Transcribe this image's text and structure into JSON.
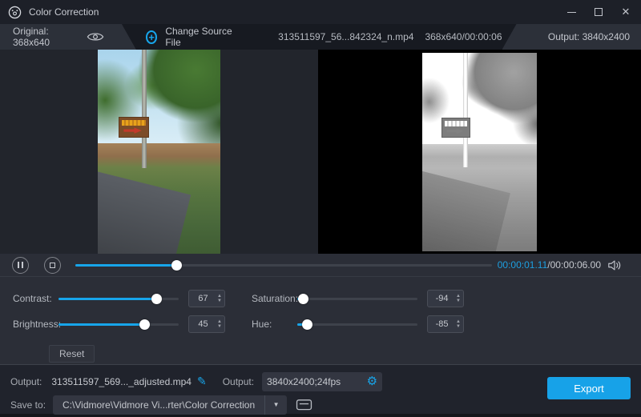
{
  "titlebar": {
    "title": "Color Correction"
  },
  "toolbar": {
    "original_tab": "Original: 368x640",
    "change_source_label": "Change Source File",
    "source_file": "313511597_56...842324_n.mp4",
    "source_info": "368x640/00:00:06",
    "output_tab": "Output: 3840x2400"
  },
  "playback": {
    "elapsed": "00:00:01.11",
    "divider": "/",
    "duration": "00:00:06.00"
  },
  "adjustments": {
    "contrast": {
      "label": "Contrast:",
      "value": "67"
    },
    "saturation": {
      "label": "Saturation:",
      "value": "-94"
    },
    "brightness": {
      "label": "Brightness:",
      "value": "45"
    },
    "hue": {
      "label": "Hue:",
      "value": "-85"
    },
    "reset": "Reset"
  },
  "output": {
    "name_label": "Output:",
    "file_name": "313511597_569..._adjusted.mp4",
    "settings_label": "Output:",
    "settings_value": "3840x2400;24fps",
    "save_label": "Save to:",
    "save_path": "C:\\Vidmore\\Vidmore Vi...rter\\Color Correction",
    "export": "Export"
  },
  "icons": {
    "plus": "+",
    "close": "✕",
    "spin_up": "▲",
    "spin_down": "▼",
    "dropdown": "▼",
    "edit": "✎",
    "gear": "⚙"
  },
  "colors": {
    "accent": "#17A5EA",
    "elapsed_time": "#1D9FE0",
    "export_button": "#17A2E8",
    "preview_bg_left": "#22252C",
    "preview_bg_right": "#000000"
  }
}
